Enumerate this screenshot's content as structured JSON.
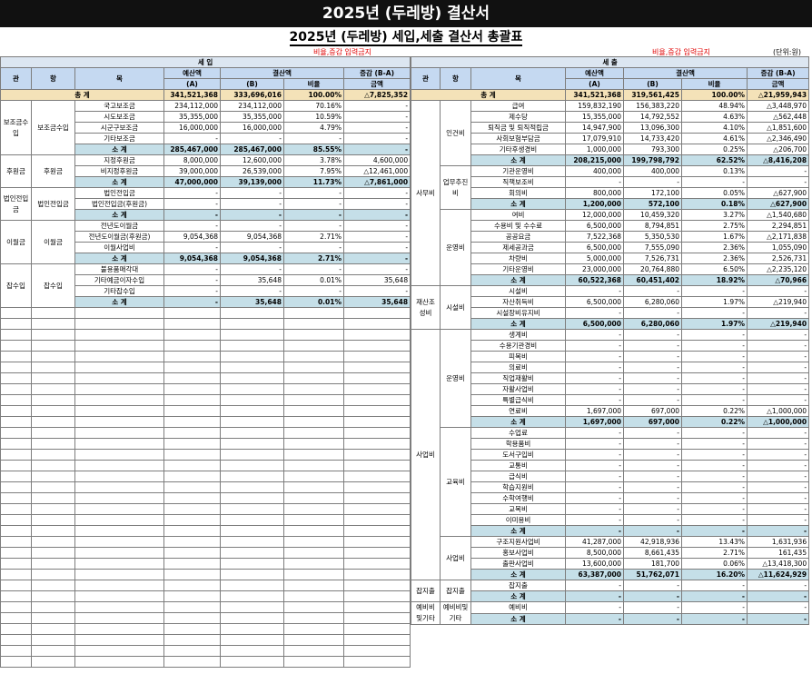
{
  "banner": "2025년 (두레방) 결산서",
  "subtitle": "2025년 (두레방) 세입,세출 결산서 총괄표",
  "warn_left": "비율,증감 입력금지",
  "warn_right": "비율,증감 입력금지",
  "unit": "(단위:원)",
  "left": {
    "section": "세        입",
    "head": {
      "gwan": "관",
      "hang": "항",
      "mok": "목",
      "budget": "예산액",
      "settle": "결산액",
      "diff": "증감 (B-A)",
      "a": "(A)",
      "b": "(B)",
      "ratio": "비율",
      "amount": "금액"
    },
    "total": {
      "label": "총        계",
      "a": "341,521,368",
      "b": "333,696,016",
      "r": "100.00%",
      "d": "△7,825,352"
    },
    "rows": [
      {
        "mok": "국고보조금",
        "a": "234,112,000",
        "b": "234,112,000",
        "r": "70.16%",
        "d": "-"
      },
      {
        "mok": "시도보조금",
        "a": "35,355,000",
        "b": "35,355,000",
        "r": "10.59%",
        "d": "-"
      },
      {
        "mok": "시군구보조금",
        "a": "16,000,000",
        "b": "16,000,000",
        "r": "4.79%",
        "d": "-"
      },
      {
        "mok": "기타보조금",
        "a": "-",
        "b": "-",
        "r": "-",
        "d": "-"
      },
      {
        "mok": "소 계",
        "a": "285,467,000",
        "b": "285,467,000",
        "r": "85.55%",
        "d": "-",
        "sub": true
      },
      {
        "mok": "지정후원금",
        "a": "8,000,000",
        "b": "12,600,000",
        "r": "3.78%",
        "d": "4,600,000"
      },
      {
        "mok": "비지정후원금",
        "a": "39,000,000",
        "b": "26,539,000",
        "r": "7.95%",
        "d": "△12,461,000"
      },
      {
        "mok": "소 계",
        "a": "47,000,000",
        "b": "39,139,000",
        "r": "11.73%",
        "d": "△7,861,000",
        "sub": true
      },
      {
        "mok": "법인전입금",
        "a": "-",
        "b": "-",
        "r": "-",
        "d": "-"
      },
      {
        "mok": "법인전입금(후원금)",
        "a": "-",
        "b": "-",
        "r": "-",
        "d": "-"
      },
      {
        "mok": "소 계",
        "a": "-",
        "b": "-",
        "r": "-",
        "d": "-",
        "sub": true
      },
      {
        "mok": "전년도이월금",
        "a": "-",
        "b": "-",
        "r": "-",
        "d": "-"
      },
      {
        "mok": "전년도이월금(후원금)",
        "a": "9,054,368",
        "b": "9,054,368",
        "r": "2.71%",
        "d": "-"
      },
      {
        "mok": "이월사업비",
        "a": "-",
        "b": "-",
        "r": "-",
        "d": "-"
      },
      {
        "mok": "소 계",
        "a": "9,054,368",
        "b": "9,054,368",
        "r": "2.71%",
        "d": "-",
        "sub": true
      },
      {
        "mok": "불용품매각대",
        "a": "-",
        "b": "-",
        "r": "-",
        "d": "-"
      },
      {
        "mok": "기타예금이자수입",
        "a": "-",
        "b": "35,648",
        "r": "0.01%",
        "d": "35,648"
      },
      {
        "mok": "기타잡수입",
        "a": "-",
        "b": "-",
        "r": "-",
        "d": "-"
      },
      {
        "mok": "소 계",
        "a": "-",
        "b": "35,648",
        "r": "0.01%",
        "d": "35,648",
        "sub": true
      }
    ],
    "groups": [
      {
        "gwan": "보조금수입",
        "hang": "보조금수입",
        "start": 0,
        "span": 5
      },
      {
        "gwan": "후원금",
        "hang": "후원금",
        "start": 5,
        "span": 3
      },
      {
        "gwan": "법인전입금",
        "hang": "법인전입금",
        "start": 8,
        "span": 3
      },
      {
        "gwan": "이월금",
        "hang": "이월금",
        "start": 11,
        "span": 4
      },
      {
        "gwan": "잡수입",
        "hang": "잡수입",
        "start": 15,
        "span": 4
      }
    ]
  },
  "right": {
    "section": "세        출",
    "head": {
      "gwan": "관",
      "hang": "항",
      "mok": "목",
      "budget": "예산액",
      "settle": "결산액",
      "diff": "증감 (B-A)",
      "a": "(A)",
      "b": "(B)",
      "ratio": "비율",
      "amount": "금액"
    },
    "total": {
      "label": "총        계",
      "a": "341,521,368",
      "b": "319,561,425",
      "r": "100.00%",
      "d": "△21,959,943"
    },
    "rows": [
      {
        "mok": "급여",
        "a": "159,832,190",
        "b": "156,383,220",
        "r": "48.94%",
        "d": "△3,448,970"
      },
      {
        "mok": "제수당",
        "a": "15,355,000",
        "b": "14,792,552",
        "r": "4.63%",
        "d": "△562,448"
      },
      {
        "mok": "퇴직금 및 퇴직적립금",
        "a": "14,947,900",
        "b": "13,096,300",
        "r": "4.10%",
        "d": "△1,851,600"
      },
      {
        "mok": "사회보험부담금",
        "a": "17,079,910",
        "b": "14,733,420",
        "r": "4.61%",
        "d": "△2,346,490"
      },
      {
        "mok": "기타후생경비",
        "a": "1,000,000",
        "b": "793,300",
        "r": "0.25%",
        "d": "△206,700"
      },
      {
        "mok": "소 계",
        "a": "208,215,000",
        "b": "199,798,792",
        "r": "62.52%",
        "d": "△8,416,208",
        "sub": true
      },
      {
        "mok": "기관운영비",
        "a": "400,000",
        "b": "400,000",
        "r": "0.13%",
        "d": "-"
      },
      {
        "mok": "직책보조비",
        "a": "-",
        "b": "-",
        "r": "-",
        "d": "-"
      },
      {
        "mok": "회의비",
        "a": "800,000",
        "b": "172,100",
        "r": "0.05%",
        "d": "△627,900"
      },
      {
        "mok": "소 계",
        "a": "1,200,000",
        "b": "572,100",
        "r": "0.18%",
        "d": "△627,900",
        "sub": true
      },
      {
        "mok": "여비",
        "a": "12,000,000",
        "b": "10,459,320",
        "r": "3.27%",
        "d": "△1,540,680"
      },
      {
        "mok": "수용비 및 수수료",
        "a": "6,500,000",
        "b": "8,794,851",
        "r": "2.75%",
        "d": "2,294,851"
      },
      {
        "mok": "공공요금",
        "a": "7,522,368",
        "b": "5,350,530",
        "r": "1.67%",
        "d": "△2,171,838"
      },
      {
        "mok": "제세공과금",
        "a": "6,500,000",
        "b": "7,555,090",
        "r": "2.36%",
        "d": "1,055,090"
      },
      {
        "mok": "차량비",
        "a": "5,000,000",
        "b": "7,526,731",
        "r": "2.36%",
        "d": "2,526,731"
      },
      {
        "mok": "기타운영비",
        "a": "23,000,000",
        "b": "20,764,880",
        "r": "6.50%",
        "d": "△2,235,120"
      },
      {
        "mok": "소 계",
        "a": "60,522,368",
        "b": "60,451,402",
        "r": "18.92%",
        "d": "△70,966",
        "sub": true
      },
      {
        "mok": "시설비",
        "a": "-",
        "b": "-",
        "r": "-",
        "d": "-"
      },
      {
        "mok": "자산취득비",
        "a": "6,500,000",
        "b": "6,280,060",
        "r": "1.97%",
        "d": "△219,940"
      },
      {
        "mok": "시설장비유지비",
        "a": "-",
        "b": "-",
        "r": "-",
        "d": "-"
      },
      {
        "mok": "소 계",
        "a": "6,500,000",
        "b": "6,280,060",
        "r": "1.97%",
        "d": "△219,940",
        "sub": true
      },
      {
        "mok": "생계비",
        "a": "-",
        "b": "-",
        "r": "-",
        "d": "-"
      },
      {
        "mok": "수용기관경비",
        "a": "-",
        "b": "-",
        "r": "-",
        "d": "-"
      },
      {
        "mok": "피복비",
        "a": "-",
        "b": "-",
        "r": "-",
        "d": "-"
      },
      {
        "mok": "의료비",
        "a": "-",
        "b": "-",
        "r": "-",
        "d": "-"
      },
      {
        "mok": "직업재활비",
        "a": "-",
        "b": "-",
        "r": "-",
        "d": "-"
      },
      {
        "mok": "자활사업비",
        "a": "-",
        "b": "-",
        "r": "-",
        "d": "-"
      },
      {
        "mok": "특별급식비",
        "a": "-",
        "b": "-",
        "r": "-",
        "d": "-"
      },
      {
        "mok": "연료비",
        "a": "1,697,000",
        "b": "697,000",
        "r": "0.22%",
        "d": "△1,000,000"
      },
      {
        "mok": "소 계",
        "a": "1,697,000",
        "b": "697,000",
        "r": "0.22%",
        "d": "△1,000,000",
        "sub": true
      },
      {
        "mok": "수업료",
        "a": "-",
        "b": "-",
        "r": "-",
        "d": "-"
      },
      {
        "mok": "학용품비",
        "a": "-",
        "b": "-",
        "r": "-",
        "d": "-"
      },
      {
        "mok": "도서구입비",
        "a": "-",
        "b": "-",
        "r": "-",
        "d": "-"
      },
      {
        "mok": "교통비",
        "a": "-",
        "b": "-",
        "r": "-",
        "d": "-"
      },
      {
        "mok": "급식비",
        "a": "-",
        "b": "-",
        "r": "-",
        "d": "-"
      },
      {
        "mok": "학습지원비",
        "a": "-",
        "b": "-",
        "r": "-",
        "d": "-"
      },
      {
        "mok": "수학여행비",
        "a": "-",
        "b": "-",
        "r": "-",
        "d": "-"
      },
      {
        "mok": "교복비",
        "a": "-",
        "b": "-",
        "r": "-",
        "d": "-"
      },
      {
        "mok": "이미용비",
        "a": "-",
        "b": "-",
        "r": "-",
        "d": "-"
      },
      {
        "mok": "소 계",
        "a": "-",
        "b": "-",
        "r": "-",
        "d": "-",
        "sub": true
      },
      {
        "mok": "구조지원사업비",
        "a": "41,287,000",
        "b": "42,918,936",
        "r": "13.43%",
        "d": "1,631,936"
      },
      {
        "mok": "홍보사업비",
        "a": "8,500,000",
        "b": "8,661,435",
        "r": "2.71%",
        "d": "161,435"
      },
      {
        "mok": "출판사업비",
        "a": "13,600,000",
        "b": "181,700",
        "r": "0.06%",
        "d": "△13,418,300"
      },
      {
        "mok": "소 계",
        "a": "63,387,000",
        "b": "51,762,071",
        "r": "16.20%",
        "d": "△11,624,929",
        "sub": true
      },
      {
        "mok": "잡지출",
        "a": "-",
        "b": "-",
        "r": "-",
        "d": "-"
      },
      {
        "mok": "소 계",
        "a": "-",
        "b": "-",
        "r": "-",
        "d": "-",
        "sub": true
      },
      {
        "mok": "예비비",
        "a": "-",
        "b": "-",
        "r": "-",
        "d": "-"
      },
      {
        "mok": "소 계",
        "a": "-",
        "b": "-",
        "r": "-",
        "d": "-",
        "sub": true
      }
    ],
    "gwan_groups": [
      {
        "label": "사무비",
        "start": 0,
        "span": 17
      },
      {
        "label": "재산조성비",
        "start": 17,
        "span": 4
      },
      {
        "label": "사업비",
        "start": 21,
        "span": 23
      },
      {
        "label": "잡지출",
        "start": 44,
        "span": 2
      },
      {
        "label": "예비비및기타",
        "start": 46,
        "span": 2
      }
    ],
    "hang_groups": [
      {
        "label": "인건비",
        "start": 0,
        "span": 6
      },
      {
        "label": "업무추진비",
        "start": 6,
        "span": 4
      },
      {
        "label": "운영비",
        "start": 10,
        "span": 7
      },
      {
        "label": "시설비",
        "start": 17,
        "span": 4
      },
      {
        "label": "운영비",
        "start": 21,
        "span": 9
      },
      {
        "label": "교육비",
        "start": 30,
        "span": 10
      },
      {
        "label": "사업비",
        "start": 40,
        "span": 4
      },
      {
        "label": "잡지출",
        "start": 44,
        "span": 2
      },
      {
        "label": "예비비및기타",
        "start": 46,
        "span": 2
      }
    ]
  }
}
